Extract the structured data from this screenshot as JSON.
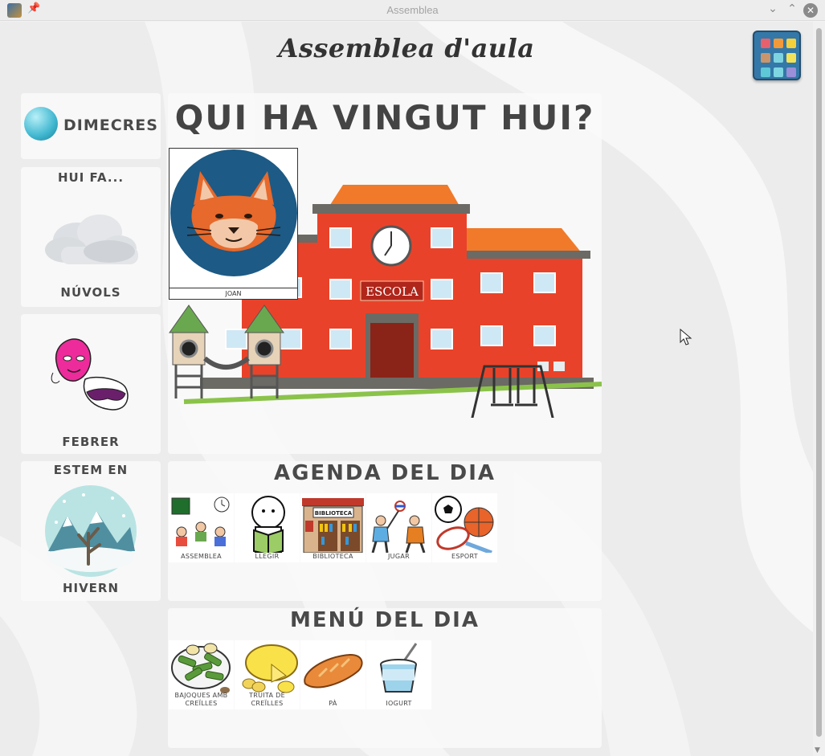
{
  "window": {
    "title": "Assemblea"
  },
  "page": {
    "title": "Assemblea d'aula"
  },
  "today": {
    "day": "DIMECRES"
  },
  "weather": {
    "heading": "HUI FA...",
    "value": "NÚVOLS",
    "icon": "cloud-icon"
  },
  "month": {
    "value": "FEBRER",
    "icon": "carnival-masks-icon"
  },
  "season": {
    "heading": "ESTEM EN",
    "value": "HIVERN",
    "icon": "winter-tree-icon"
  },
  "attendance": {
    "heading": "QUI HA VINGUT HUI?",
    "students": [
      {
        "name": "JOAN",
        "icon": "fox-icon"
      }
    ],
    "sign": "ESCOLA"
  },
  "agenda": {
    "heading": "AGENDA DEL DIA",
    "items": [
      {
        "label": "ASSEMBLEA",
        "icon": "assembly-icon"
      },
      {
        "label": "LLEGIR",
        "icon": "reading-icon"
      },
      {
        "label": "BIBLIOTECA",
        "icon": "library-icon"
      },
      {
        "label": "JUGAR",
        "icon": "playing-icon"
      },
      {
        "label": "ESPORT",
        "icon": "sports-icon"
      }
    ],
    "library_sign": "BIBLIOTECA"
  },
  "menu": {
    "heading": "MENÚ DEL DIA",
    "items": [
      {
        "label_line1": "BAJOQUES AMB",
        "label_line2": "CREÏLLES",
        "icon": "green-beans-icon"
      },
      {
        "label_line1": "TRUITA DE",
        "label_line2": "CREÏLLES",
        "icon": "omelette-icon"
      },
      {
        "label_line1": "PÀ",
        "label_line2": "",
        "icon": "bread-icon"
      },
      {
        "label_line1": "IOGURT",
        "label_line2": "",
        "icon": "yogurt-icon"
      }
    ]
  },
  "colors": {
    "building": "#e8432a",
    "roof": "#f07a2a",
    "panel": "#fafafa",
    "apps_button": "#3378a8"
  }
}
